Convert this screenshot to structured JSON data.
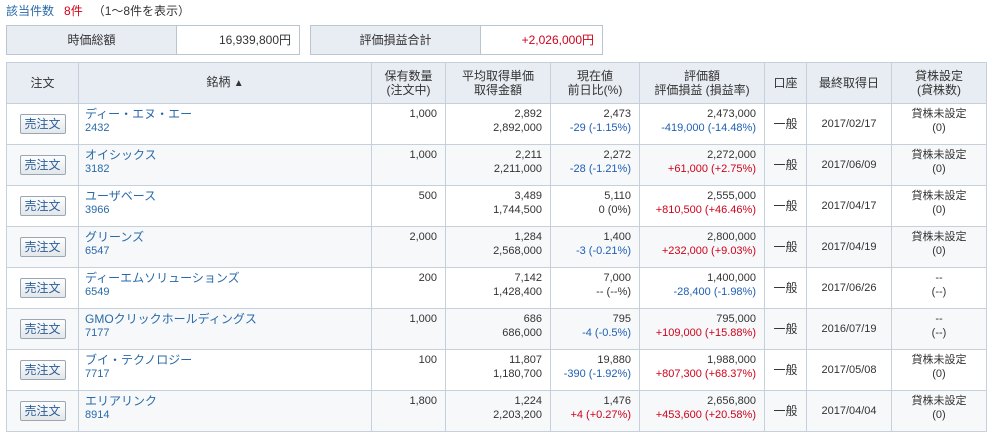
{
  "summary": {
    "count_label": "該当件数",
    "count": "8件",
    "range": "（1〜8件を表示）",
    "market_value_label": "時価総額",
    "market_value": "16,939,800円",
    "pl_total_label": "評価損益合計",
    "pl_total": "+2,026,000円"
  },
  "headers": {
    "order": "注文",
    "name": "銘柄",
    "sort_arrow": "▲",
    "qty1": "保有数量",
    "qty2": "(注文中)",
    "avg1": "平均取得単価",
    "avg2": "取得金額",
    "price1": "現在値",
    "price2": "前日比(%)",
    "val1": "評価額",
    "val2": "評価損益 (損益率)",
    "account": "口座",
    "last": "最終取得日",
    "lend1": "貸株設定",
    "lend2": "(貸株数)"
  },
  "sell_label": "売注文",
  "rows": [
    {
      "name": "ディー・エヌ・エー",
      "code": "2432",
      "qty": "1,000",
      "avg": "2,892",
      "cost": "2,892,000",
      "price": "2,473",
      "chg": "-29 (-1.15%)",
      "chg_sign": "neg",
      "value": "2,473,000",
      "pl": "-419,000 (-14.48%)",
      "pl_sign": "neg",
      "account": "一般",
      "date": "2017/02/17",
      "lend1": "貸株未設定",
      "lend2": "(0)"
    },
    {
      "name": "オイシックス",
      "code": "3182",
      "qty": "1,000",
      "avg": "2,211",
      "cost": "2,211,000",
      "price": "2,272",
      "chg": "-28 (-1.21%)",
      "chg_sign": "neg",
      "value": "2,272,000",
      "pl": "+61,000 (+2.75%)",
      "pl_sign": "pos",
      "account": "一般",
      "date": "2017/06/09",
      "lend1": "貸株未設定",
      "lend2": "(0)"
    },
    {
      "name": "ユーザベース",
      "code": "3966",
      "qty": "500",
      "avg": "3,489",
      "cost": "1,744,500",
      "price": "5,110",
      "chg": "0 (0%)",
      "chg_sign": "zero",
      "value": "2,555,000",
      "pl": "+810,500 (+46.46%)",
      "pl_sign": "pos",
      "account": "一般",
      "date": "2017/04/17",
      "lend1": "貸株未設定",
      "lend2": "(0)"
    },
    {
      "name": "グリーンズ",
      "code": "6547",
      "qty": "2,000",
      "avg": "1,284",
      "cost": "2,568,000",
      "price": "1,400",
      "chg": "-3 (-0.21%)",
      "chg_sign": "neg",
      "value": "2,800,000",
      "pl": "+232,000 (+9.03%)",
      "pl_sign": "pos",
      "account": "一般",
      "date": "2017/04/19",
      "lend1": "貸株未設定",
      "lend2": "(0)"
    },
    {
      "name": "ディーエムソリューションズ",
      "code": "6549",
      "qty": "200",
      "avg": "7,142",
      "cost": "1,428,400",
      "price": "7,000",
      "chg": "-- (--%)",
      "chg_sign": "zero",
      "value": "1,400,000",
      "pl": "-28,400 (-1.98%)",
      "pl_sign": "neg",
      "account": "一般",
      "date": "2017/06/26",
      "lend1": "--",
      "lend2": "(--)"
    },
    {
      "name": "GMOクリックホールディングス",
      "code": "7177",
      "qty": "1,000",
      "avg": "686",
      "cost": "686,000",
      "price": "795",
      "chg": "-4 (-0.5%)",
      "chg_sign": "neg",
      "value": "795,000",
      "pl": "+109,000 (+15.88%)",
      "pl_sign": "pos",
      "account": "一般",
      "date": "2016/07/19",
      "lend1": "--",
      "lend2": "(--)"
    },
    {
      "name": "ブイ・テクノロジー",
      "code": "7717",
      "qty": "100",
      "avg": "11,807",
      "cost": "1,180,700",
      "price": "19,880",
      "chg": "-390 (-1.92%)",
      "chg_sign": "neg",
      "value": "1,988,000",
      "pl": "+807,300 (+68.37%)",
      "pl_sign": "pos",
      "account": "一般",
      "date": "2017/05/08",
      "lend1": "貸株未設定",
      "lend2": "(0)"
    },
    {
      "name": "エリアリンク",
      "code": "8914",
      "qty": "1,800",
      "avg": "1,224",
      "cost": "2,203,200",
      "price": "1,476",
      "chg": "+4 (+0.27%)",
      "chg_sign": "pos",
      "value": "2,656,800",
      "pl": "+453,600 (+20.58%)",
      "pl_sign": "pos",
      "account": "一般",
      "date": "2017/04/04",
      "lend1": "貸株未設定",
      "lend2": "(0)"
    }
  ],
  "colors": {
    "positive": "#d0021b",
    "negative": "#1f5fb4",
    "link": "#2a6aa8"
  }
}
